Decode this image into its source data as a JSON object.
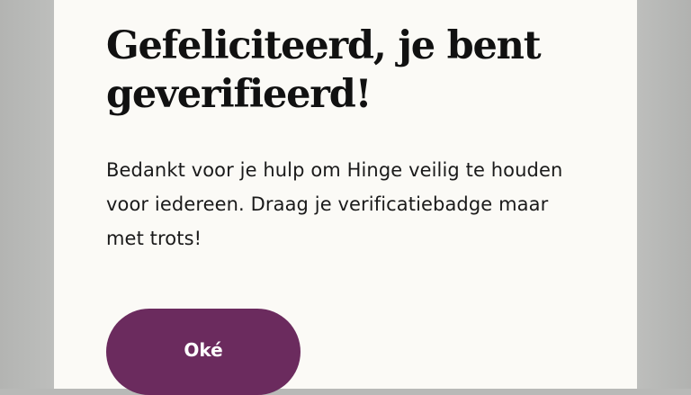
{
  "dialog": {
    "title": "Gefeliciteerd, je bent geverifieerd!",
    "message": "Bedankt voor je hulp om Hinge veilig te houden voor iedereen. Draag je verificatiebadge maar met trots!",
    "confirm_label": "Oké"
  },
  "colors": {
    "button_background": "#6b2b5e",
    "dialog_background": "#fbfaf6",
    "overlay": "#b8b9b7"
  }
}
